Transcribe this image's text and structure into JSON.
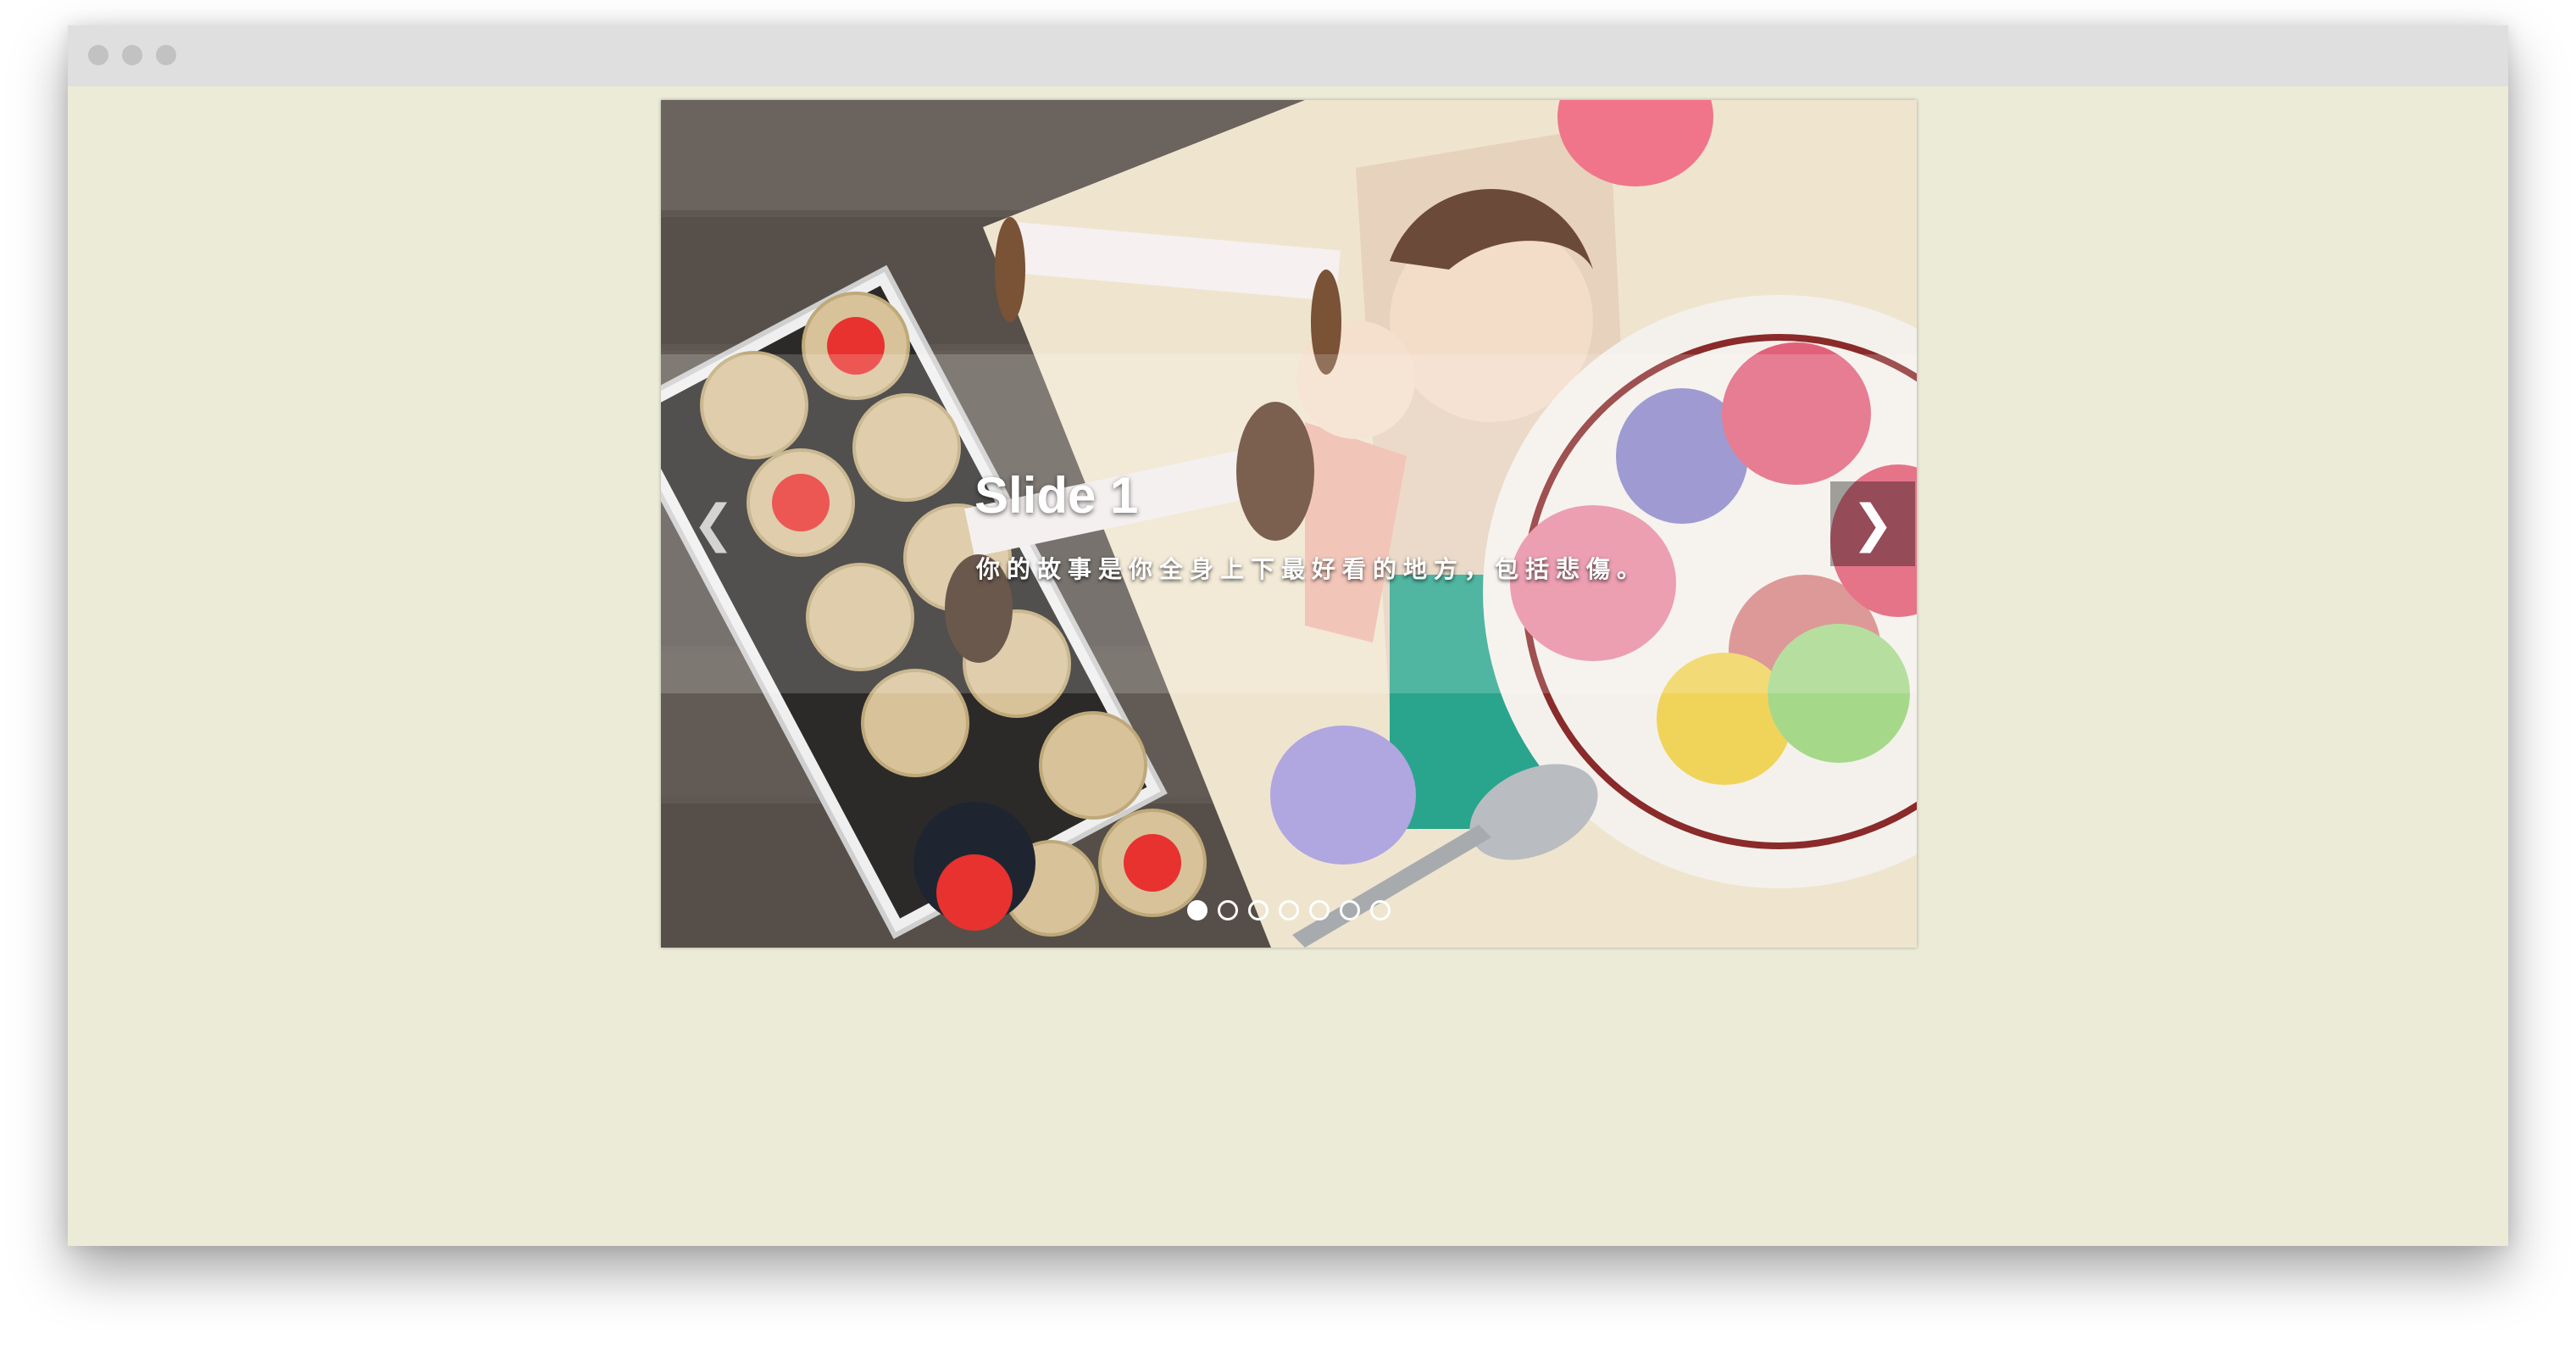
{
  "window": {
    "title_dots": [
      "close",
      "minimize",
      "zoom"
    ]
  },
  "slider": {
    "current_index": 0,
    "slide_count": 7,
    "caption": {
      "title": "Slide 1",
      "text": "你的故事是你全身上下最好看的地方，包括悲傷。"
    },
    "prev_label": "❮",
    "next_label": "❯",
    "image_description_icon": "photo-sewing-macarons"
  },
  "colors": {
    "page_background": "#ecebd8",
    "titlebar": "#dfdfdf",
    "caption_text": "#ffffff"
  }
}
